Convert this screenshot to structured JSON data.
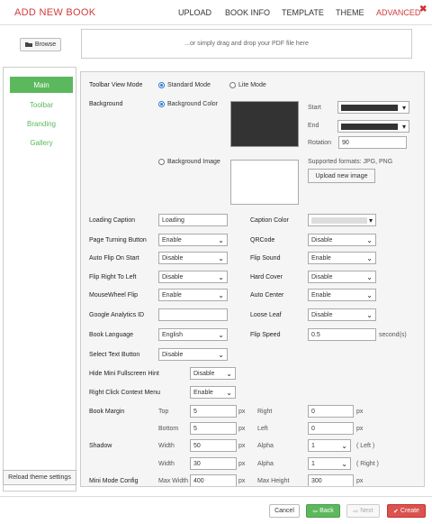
{
  "header": {
    "title": "ADD NEW BOOK",
    "tabs": [
      "UPLOAD",
      "BOOK INFO",
      "TEMPLATE",
      "THEME",
      "ADVANCED"
    ],
    "active_tab": "ADVANCED",
    "close": "✖"
  },
  "upload": {
    "browse_label": "Browse",
    "drop_text": "...or simply drag and drop your PDF file here"
  },
  "sidebar": {
    "items": [
      "Main",
      "Toolbar",
      "Branding",
      "Gallery"
    ],
    "reload_label": "Reload theme settings"
  },
  "form": {
    "toolbar_view_mode": {
      "label": "Toolbar View Mode",
      "options": [
        "Standard Mode",
        "Lite Mode"
      ],
      "selected": "Standard Mode"
    },
    "background": {
      "label": "Background",
      "color_option": "Background Color",
      "image_option": "Background Image",
      "start_label": "Start",
      "end_label": "End",
      "rotation_label": "Rotation",
      "rotation_value": "90",
      "supported": "Supported formats: JPG, PNG",
      "upload_label": "Upload new image",
      "swatch_color": "#333333"
    },
    "loading_caption": {
      "label": "Loading Caption",
      "value": "Loading"
    },
    "caption_color": {
      "label": "Caption Color"
    },
    "page_turning_button": {
      "label": "Page Turning Button",
      "value": "Enable"
    },
    "qrcode": {
      "label": "QRCode",
      "value": "Disable"
    },
    "auto_flip": {
      "label": "Auto Flip On Start",
      "value": "Disable"
    },
    "flip_sound": {
      "label": "Flip Sound",
      "value": "Enable"
    },
    "flip_rtl": {
      "label": "Flip Right To Left",
      "value": "Disable"
    },
    "hard_cover": {
      "label": "Hard Cover",
      "value": "Disable"
    },
    "mousewheel": {
      "label": "MouseWheel Flip",
      "value": "Enable"
    },
    "auto_center": {
      "label": "Auto Center",
      "value": "Enable"
    },
    "analytics": {
      "label": "Google Analytics ID",
      "value": ""
    },
    "loose_leaf": {
      "label": "Loose Leaf",
      "value": "Disable"
    },
    "book_language": {
      "label": "Book Language",
      "value": "English"
    },
    "flip_speed": {
      "label": "Flip Speed",
      "value": "0.5",
      "unit": "second(s)"
    },
    "select_text": {
      "label": "Select Text Button",
      "value": "Disable"
    },
    "hide_mini": {
      "label": "Hide Mini Fullscreen Hint",
      "value": "Disable"
    },
    "right_click": {
      "label": "Right Click Context Menu",
      "value": "Enable"
    },
    "margin": {
      "label": "Book Margin",
      "top_label": "Top",
      "top": "5",
      "right_label": "Right",
      "right": "0",
      "bottom_label": "Bottom",
      "bottom": "5",
      "left_label": "Left",
      "left": "0",
      "unit": "px"
    },
    "shadow": {
      "label": "Shadow",
      "width_label": "Width",
      "alpha_label": "Alpha",
      "left_width": "50",
      "left_alpha": "1",
      "left_side": "( Left )",
      "right_width": "30",
      "right_alpha": "1",
      "right_side": "( Right )",
      "unit": "px"
    },
    "mini_mode": {
      "label": "Mini Mode Config",
      "max_width_label": "Max Width",
      "max_width": "400",
      "max_height_label": "Max Height",
      "max_height": "300",
      "unit": "px"
    }
  },
  "footer": {
    "cancel": "Cancel",
    "back": "Back",
    "next": "Next",
    "create": "Create"
  },
  "colors": {
    "accent": "#d33a3a",
    "green": "#5cb85c",
    "create_bg": "#d9534f",
    "back_bg": "#5cb85c"
  }
}
